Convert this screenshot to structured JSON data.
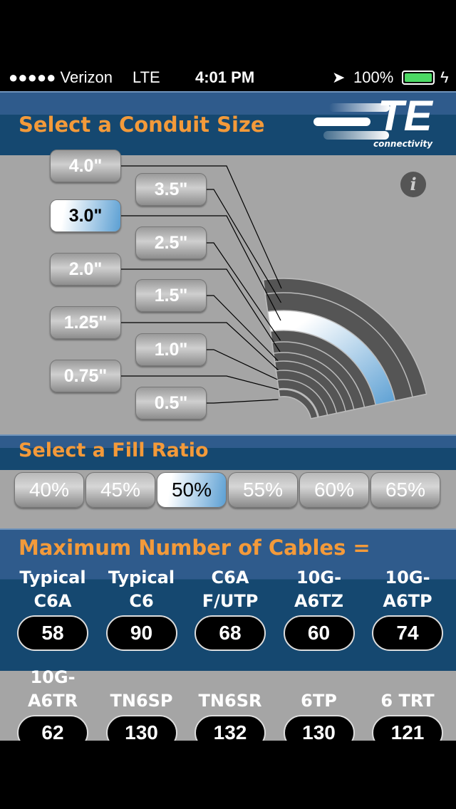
{
  "status_bar": {
    "carrier": "●●●●● Verizon",
    "network": "LTE",
    "time": "4:01 PM",
    "battery": "100%"
  },
  "header": {
    "title": "Select a Conduit Size",
    "logo_text": "TE",
    "logo_sub": "connectivity"
  },
  "conduit": {
    "selected": "3.0\"",
    "sizes": [
      "4.0\"",
      "3.5\"",
      "3.0\"",
      "2.5\"",
      "2.0\"",
      "1.5\"",
      "1.25\"",
      "1.0\"",
      "0.75\"",
      "0.5\""
    ],
    "info_icon": "info-icon"
  },
  "fill": {
    "title": "Select a Fill Ratio",
    "selected": "50%",
    "options": [
      "40%",
      "45%",
      "50%",
      "55%",
      "60%",
      "65%"
    ]
  },
  "cables": {
    "title": "Maximum Number of Cables =",
    "items": [
      {
        "l1": "Typical",
        "l2": "C6A",
        "value": "58"
      },
      {
        "l1": "Typical",
        "l2": "C6",
        "value": "90"
      },
      {
        "l1": "C6A",
        "l2": "F/UTP",
        "value": "68"
      },
      {
        "l1": "10G-",
        "l2": "A6TZ",
        "value": "60"
      },
      {
        "l1": "10G-",
        "l2": "A6TP",
        "value": "74"
      },
      {
        "l1": "10G-",
        "l2": "A6TR",
        "value": "62"
      },
      {
        "l1": "",
        "l2": "TN6SP",
        "value": "130"
      },
      {
        "l1": "",
        "l2": "TN6SR",
        "value": "132"
      },
      {
        "l1": "",
        "l2": "6TP",
        "value": "130"
      },
      {
        "l1": "",
        "l2": "6 TRT",
        "value": "121"
      }
    ]
  },
  "colors": {
    "accent": "#f39a3a",
    "header_blue": "#154870",
    "selected_blue": "#5b9fd3",
    "battery": "#4cd964"
  }
}
